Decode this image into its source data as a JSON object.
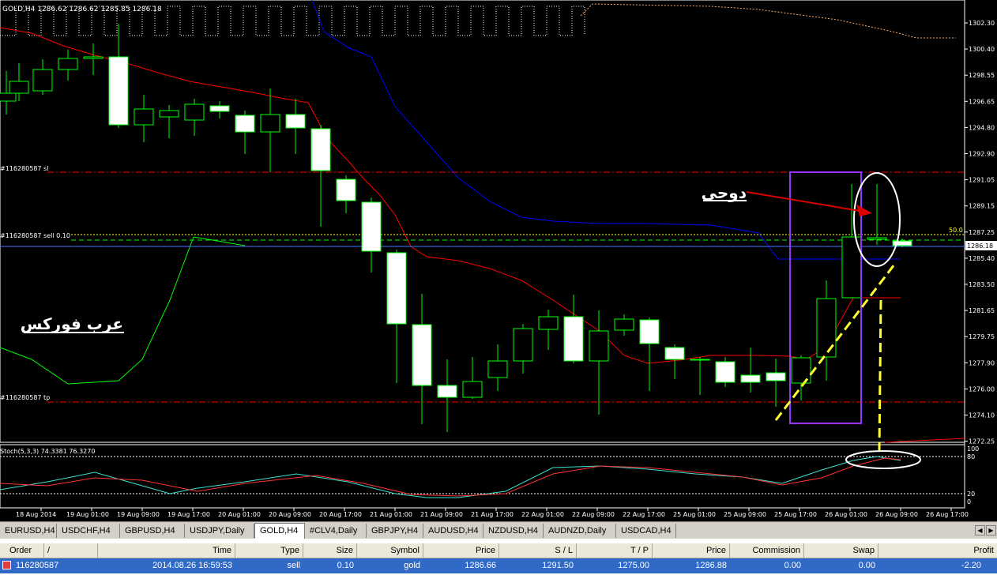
{
  "chart": {
    "header": "GOLD,H4  1286.62 1286.62 1285.85 1286.18",
    "price_axis": [
      "1302.30",
      "1300.40",
      "1298.55",
      "1296.65",
      "1294.80",
      "1292.90",
      "1291.05",
      "1289.15",
      "1287.25",
      "1285.40",
      "1283.50",
      "1281.65",
      "1279.75",
      "1277.90",
      "1276.00",
      "1274.10",
      "1272.25"
    ],
    "current_price": "1286.18",
    "level_50": "50.0",
    "sl_label": "#116280587 sl",
    "sell_label": "#116280587 sell 0.10",
    "tp_label": "#116280587 tp",
    "stoch_label": "Stoch(5,3,3) 74.3381 76.3270",
    "stoch_axis": [
      "100",
      "80",
      "20",
      "0"
    ],
    "time_axis": [
      "18 Aug 2014",
      "19 Aug 01:00",
      "19 Aug 09:00",
      "19 Aug 17:00",
      "20 Aug 01:00",
      "20 Aug 09:00",
      "20 Aug 17:00",
      "21 Aug 01:00",
      "21 Aug 09:00",
      "21 Aug 17:00",
      "22 Aug 01:00",
      "22 Aug 09:00",
      "22 Aug 17:00",
      "25 Aug 01:00",
      "25 Aug 09:00",
      "25 Aug 17:00",
      "26 Aug 01:00",
      "26 Aug 09:00",
      "26 Aug 17:00"
    ],
    "annotation_doji": "دوجى",
    "annotation_brand": "عرب فوركس",
    "colors": {
      "bull": "#000000",
      "bear": "#ffffff",
      "wick": "#00ff00",
      "ma_red": "#ff0000",
      "ma_blue": "#0000ff",
      "purple": "#9933ff",
      "yellow": "#ffff33"
    }
  },
  "tabs": [
    {
      "label": "EURUSD,H4",
      "active": false
    },
    {
      "label": "USDCHF,H4",
      "active": false
    },
    {
      "label": "GBPUSD,H4",
      "active": false
    },
    {
      "label": "USDJPY,Daily",
      "active": false
    },
    {
      "label": "GOLD,H4",
      "active": true
    },
    {
      "label": "#CLV4,Daily",
      "active": false
    },
    {
      "label": "GBPJPY,H4",
      "active": false
    },
    {
      "label": "AUDUSD,H4",
      "active": false
    },
    {
      "label": "NZDUSD,H4",
      "active": false
    },
    {
      "label": "AUDNZD,Daily",
      "active": false
    },
    {
      "label": "USDCAD,H4",
      "active": false
    }
  ],
  "terminal": {
    "columns": [
      "Order",
      "/",
      "Time",
      "Type",
      "Size",
      "Symbol",
      "Price",
      "S / L",
      "T / P",
      "Price",
      "Commission",
      "Swap",
      "Profit"
    ],
    "row": {
      "order": "116280587",
      "time": "2014.08.26 16:59:53",
      "type": "sell",
      "size": "0.10",
      "symbol": "gold",
      "price": "1286.66",
      "sl": "1291.50",
      "tp": "1275.00",
      "cur_price": "1286.88",
      "commission": "0.00",
      "swap": "0.00",
      "profit": "-2.20"
    }
  }
}
